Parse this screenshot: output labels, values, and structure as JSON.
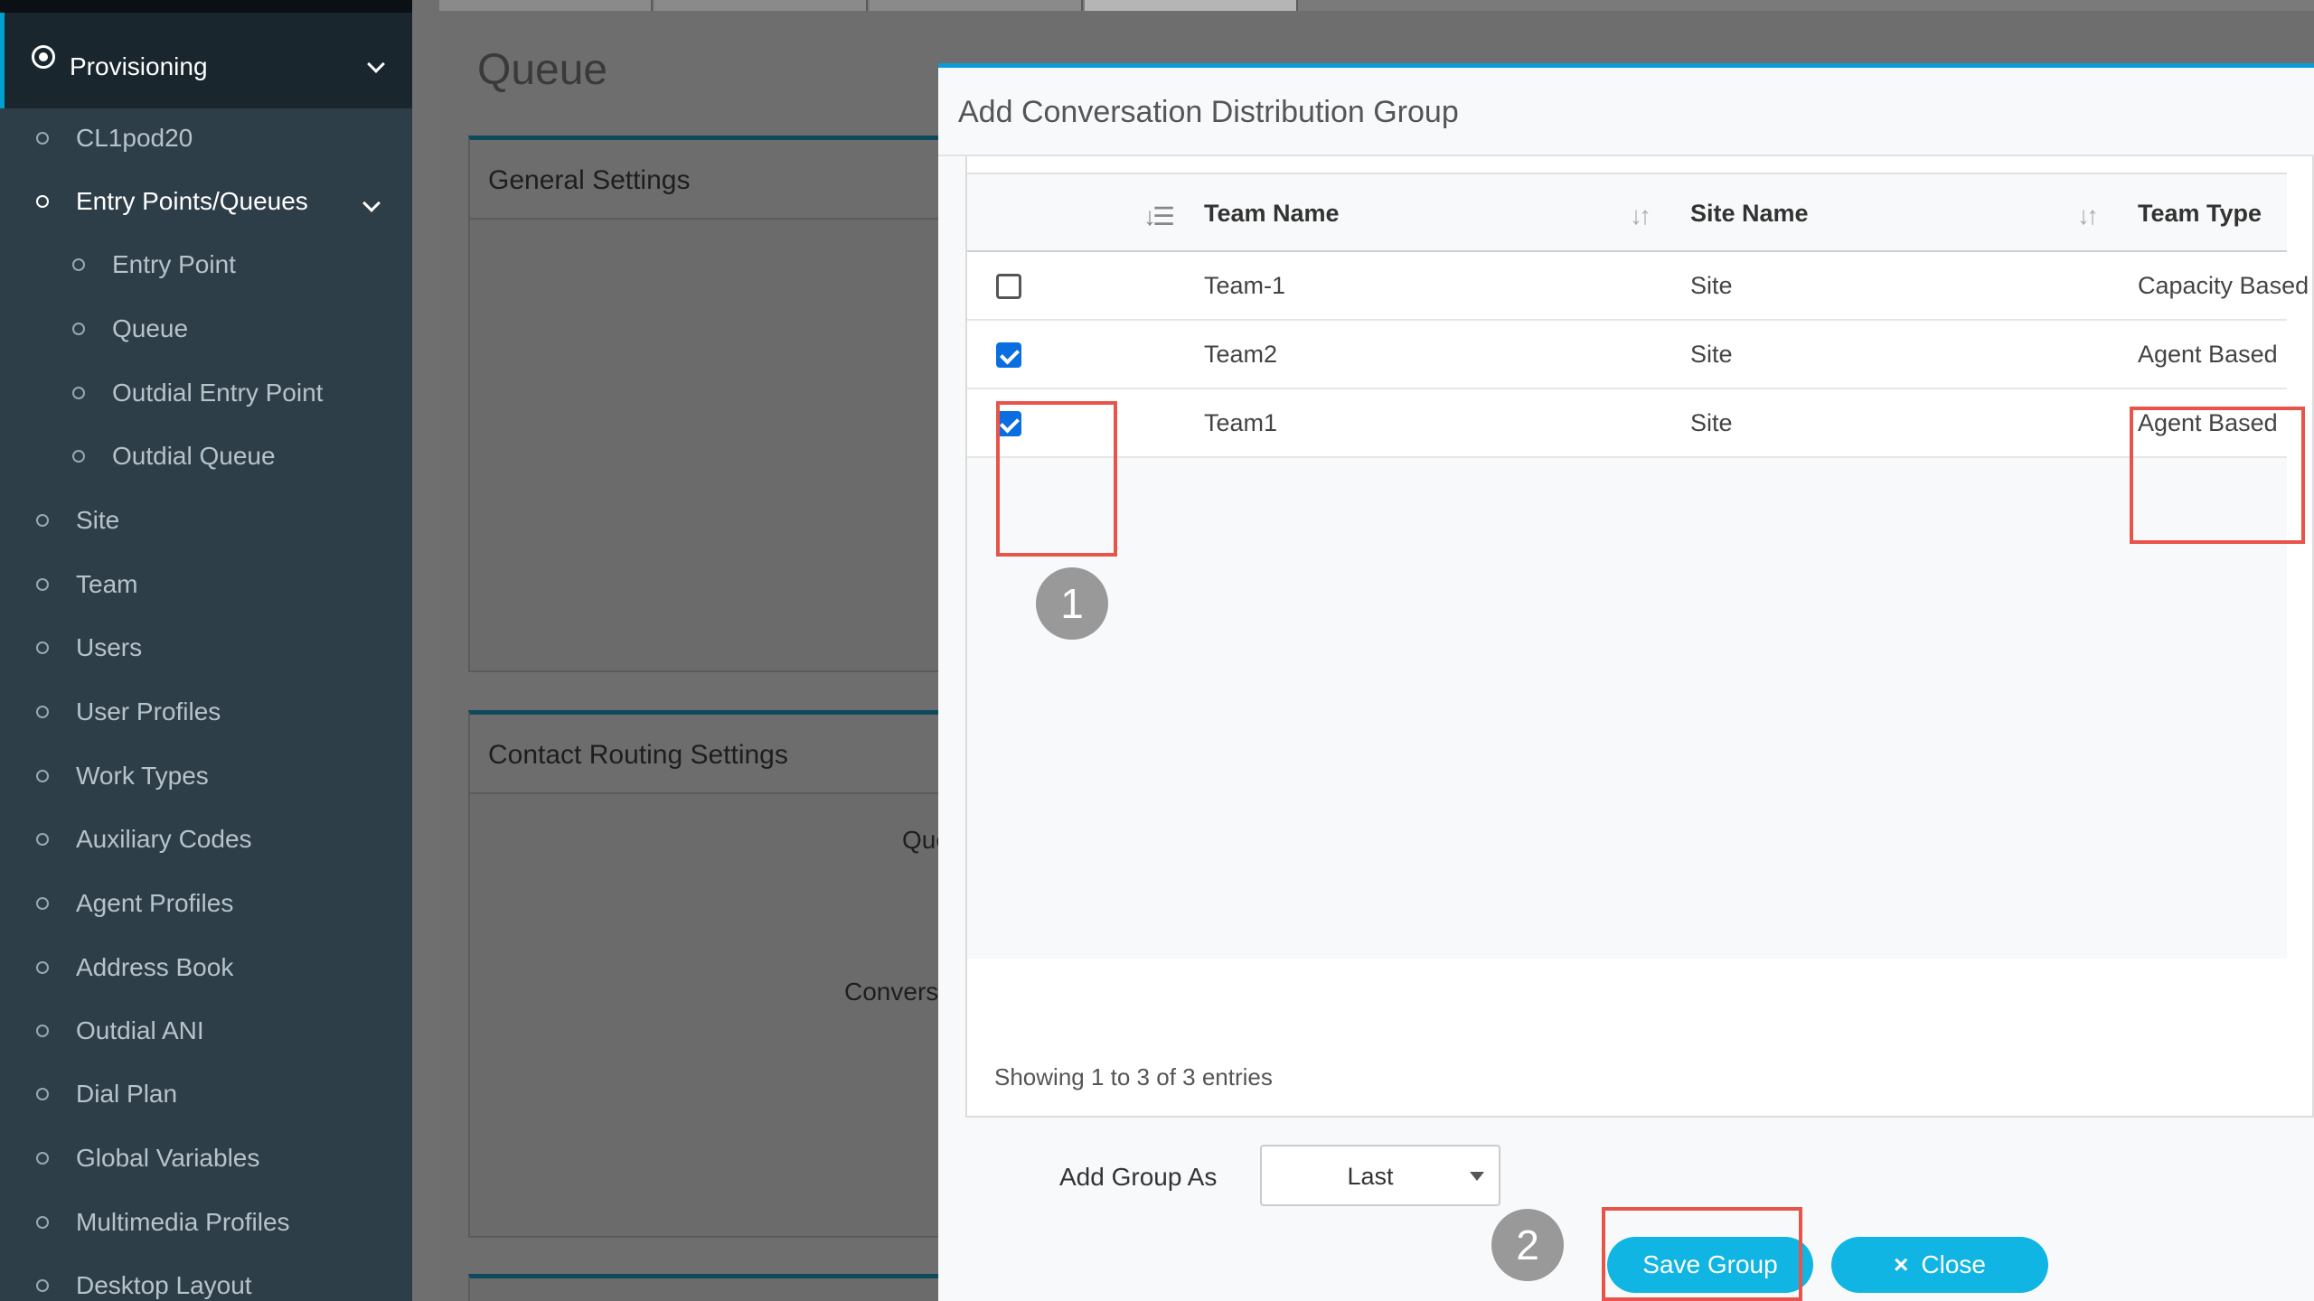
{
  "sidebar": {
    "section_title": "Provisioning",
    "items": [
      {
        "label": "CL1pod20"
      },
      {
        "label": "Entry Points/Queues"
      },
      {
        "label": "Entry Point"
      },
      {
        "label": "Queue"
      },
      {
        "label": "Outdial Entry Point"
      },
      {
        "label": "Outdial Queue"
      },
      {
        "label": "Site"
      },
      {
        "label": "Team"
      },
      {
        "label": "Users"
      },
      {
        "label": "User Profiles"
      },
      {
        "label": "Work Types"
      },
      {
        "label": "Auxiliary Codes"
      },
      {
        "label": "Agent Profiles"
      },
      {
        "label": "Address Book"
      },
      {
        "label": "Outdial ANI"
      },
      {
        "label": "Dial Plan"
      },
      {
        "label": "Global Variables"
      },
      {
        "label": "Multimedia Profiles"
      },
      {
        "label": "Desktop Layout"
      }
    ]
  },
  "page": {
    "title": "Queue",
    "general_settings": "General Settings",
    "contact_routing_settings": "Contact Routing Settings",
    "frag_queue": "Que",
    "frag_conversation": "Conversa"
  },
  "modal": {
    "title": "Add Conversation Distribution Group",
    "columns": {
      "team_name": "Team Name",
      "site_name": "Site Name",
      "team_type": "Team Type"
    },
    "rows": [
      {
        "checked": false,
        "team_name": "Team-1",
        "site_name": "Site",
        "team_type": "Capacity Based"
      },
      {
        "checked": true,
        "team_name": "Team2",
        "site_name": "Site",
        "team_type": "Agent Based"
      },
      {
        "checked": true,
        "team_name": "Team1",
        "site_name": "Site",
        "team_type": "Agent Based"
      }
    ],
    "entries_text": "Showing 1 to 3 of 3 entries",
    "add_group_as_label": "Add Group As",
    "add_group_as_value": "Last",
    "save_button": "Save Group",
    "close_button": "Close",
    "close_icon": "×"
  },
  "callouts": {
    "step1": "1",
    "step2": "2"
  },
  "colors": {
    "accent": "#10b5e4",
    "highlight": "#e8544a",
    "sidebar": "#2e3e48"
  }
}
